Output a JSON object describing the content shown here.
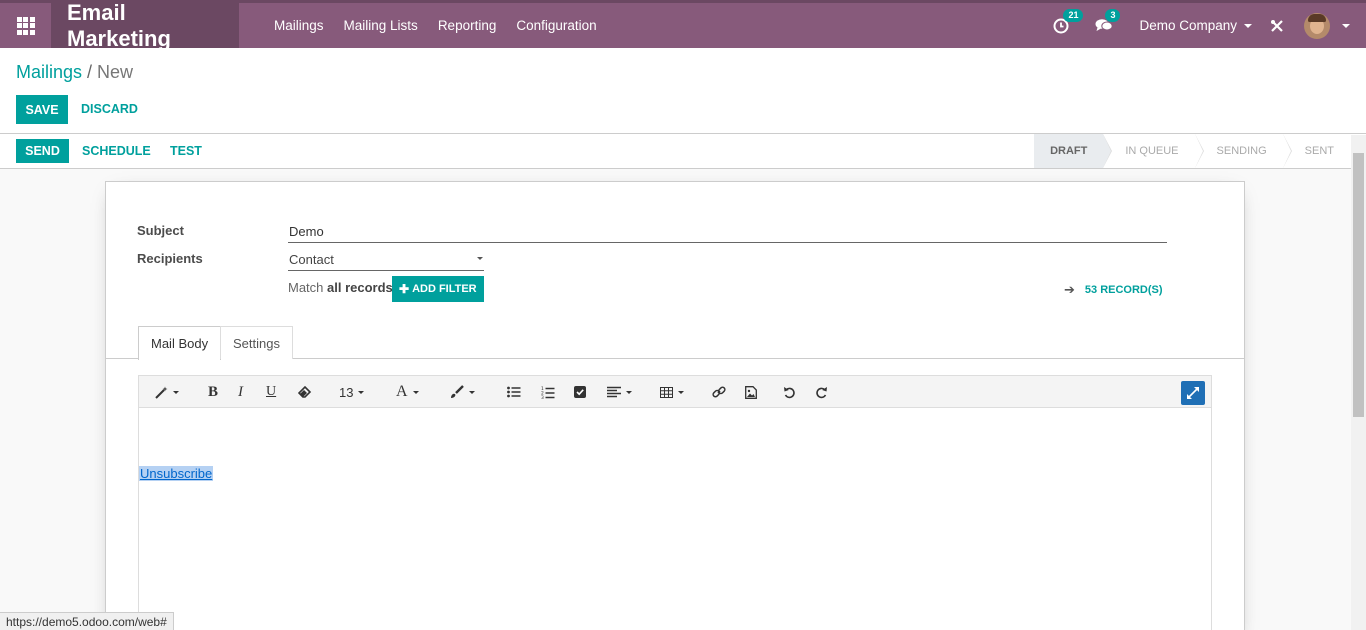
{
  "navbar": {
    "brand": "Email Marketing",
    "menu": [
      "Mailings",
      "Mailing Lists",
      "Reporting",
      "Configuration"
    ],
    "activity_count": "21",
    "messages_count": "3",
    "company": "Demo Company"
  },
  "breadcrumb": {
    "parent": "Mailings",
    "separator": "/",
    "current": "New"
  },
  "control": {
    "save_label": "SAVE",
    "discard_label": "DISCARD"
  },
  "statusbar": {
    "send_label": "SEND",
    "schedule_label": "SCHEDULE",
    "test_label": "TEST",
    "stages": [
      "DRAFT",
      "IN QUEUE",
      "SENDING",
      "SENT"
    ],
    "active_stage": "DRAFT"
  },
  "form": {
    "subject_label": "Subject",
    "subject_value": "Demo",
    "recipients_label": "Recipients",
    "recipients_value": "Contact",
    "match_prefix": "Match",
    "match_bold": "all records",
    "add_filter_label": "ADD FILTER",
    "records_label": "53 RECORD(S)"
  },
  "tabs": [
    "Mail Body",
    "Settings"
  ],
  "editor": {
    "font_size": "13",
    "body_link": "Unsubscribe"
  },
  "status_url": "https://demo5.odoo.com/web#",
  "colors": {
    "primary": "#00a09d",
    "navbar": "#875a7b",
    "brand_bg": "#6b4862"
  }
}
